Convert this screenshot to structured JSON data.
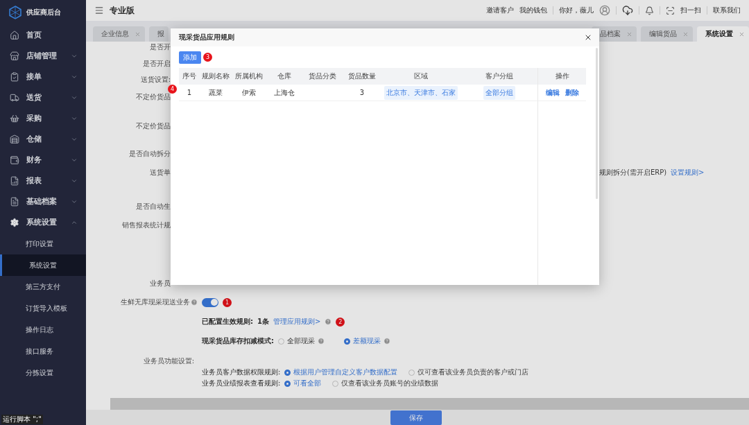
{
  "app": {
    "title": "供应商后台",
    "edition": "专业版"
  },
  "topbar": {
    "links": [
      "邀请客户",
      "我的钱包"
    ],
    "greeting": "你好，薇儿",
    "scan": "扫一扫",
    "contact": "联系我们"
  },
  "sidebar": {
    "items": [
      {
        "label": "首页",
        "expandable": false
      },
      {
        "label": "店铺管理",
        "expandable": true
      },
      {
        "label": "接单",
        "expandable": true
      },
      {
        "label": "送货",
        "expandable": true
      },
      {
        "label": "采购",
        "expandable": true
      },
      {
        "label": "仓储",
        "expandable": true
      },
      {
        "label": "财务",
        "expandable": true
      },
      {
        "label": "报表",
        "expandable": true
      },
      {
        "label": "基础档案",
        "expandable": true
      },
      {
        "label": "系统设置",
        "expanded": true,
        "expandable": true,
        "children": [
          {
            "label": "打印设置",
            "selected": false
          },
          {
            "label": "系统设置",
            "selected": true
          },
          {
            "label": "第三方支付",
            "selected": false
          },
          {
            "label": "订货导入模板",
            "selected": false
          },
          {
            "label": "操作日志",
            "selected": false
          },
          {
            "label": "接口服务",
            "selected": false
          },
          {
            "label": "分拣设置",
            "selected": false
          }
        ]
      }
    ]
  },
  "tabs": [
    {
      "label": "企业信息",
      "selected": false,
      "closable": true
    },
    {
      "label": "报",
      "selected": false,
      "closable": false
    },
    {
      "label": "品档案",
      "selected": false,
      "closable": true
    },
    {
      "label": "编辑货品",
      "selected": false,
      "closable": true
    },
    {
      "label": "系统设置",
      "selected": true,
      "closable": true
    }
  ],
  "settings": [
    {
      "kind": "clipped",
      "label": "是否开"
    },
    {
      "kind": "clipped",
      "label": "是否开启"
    },
    {
      "kind": "clipped",
      "label": "送货设置:"
    },
    {
      "kind": "clipped",
      "label": "不定价货品"
    },
    {
      "kind": "clipped",
      "label": "不定价货品"
    },
    {
      "kind": "clipped",
      "label": "是否自动拆分"
    },
    {
      "kind": "clipped",
      "label": "送货单",
      "trailing": {
        "text": "规则拆分(需开启ERP)",
        "link": "设置规则>"
      }
    },
    {
      "kind": "clipped",
      "label": "是否自动生"
    },
    {
      "kind": "clipped",
      "label": "销售报表统计规"
    },
    {
      "kind": "clipped",
      "label": "业务员"
    },
    {
      "kind": "toggle",
      "label": "生鲜无库现采现送业务",
      "on": true,
      "marker": "1"
    },
    {
      "kind": "rules",
      "label": "已配置生效规则:",
      "count": "1条",
      "link": "管理应用规则>",
      "marker": "2"
    },
    {
      "kind": "radio",
      "label": "现采货品库存扣减模式:",
      "help": true,
      "options": [
        {
          "label": "全部现采",
          "selected": false
        },
        {
          "label": "差额现采",
          "selected": true
        }
      ]
    },
    {
      "kind": "heading",
      "label": "业务员功能设置:"
    },
    {
      "kind": "radio",
      "label": "业务员客户数据权限规则:",
      "help": false,
      "options": [
        {
          "label": "根据用户管理自定义客户数据配置",
          "selected": true
        },
        {
          "label": "仅可查看该业务员负责的客户或门店",
          "selected": false
        }
      ]
    },
    {
      "kind": "radio",
      "label": "业务员业绩报表查看规则:",
      "help": false,
      "options": [
        {
          "label": "可看全部",
          "selected": true
        },
        {
          "label": "仅查看该业务员账号的业绩数据",
          "selected": false
        }
      ]
    }
  ],
  "footer": {
    "save": "保存"
  },
  "status_text": "运行脚本 \";\"",
  "modal": {
    "title": "现采货品应用规则",
    "add": "添加",
    "add_marker": "3",
    "row_marker": "4",
    "columns": [
      "序号",
      "规则名称",
      "所属机构",
      "仓库",
      "货品分类",
      "货品数量",
      "区域",
      "客户分组",
      "操作"
    ],
    "rows": [
      {
        "index": "1",
        "name": "蔬菜",
        "org": "伊索",
        "warehouse": "上海仓",
        "quantity": "3",
        "region": "北京市、天津市、石家",
        "group": "全部分组",
        "actions": [
          "编辑",
          "删除"
        ]
      }
    ]
  }
}
